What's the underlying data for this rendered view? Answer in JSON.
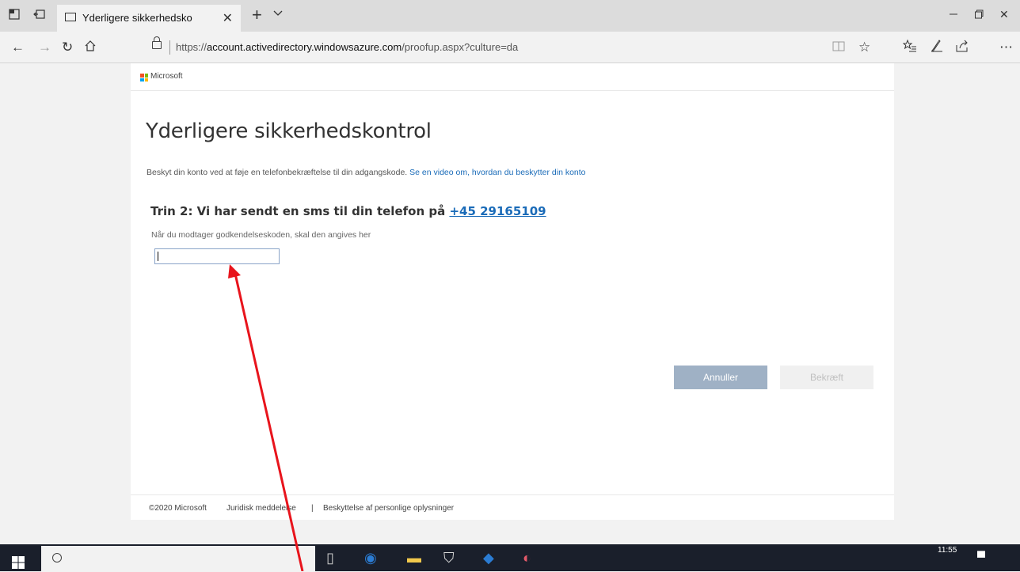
{
  "browser": {
    "tab_title": "Yderligere sikkerhedsko",
    "url_prefix": "https://",
    "url_domain": "account.activedirectory.windowsazure.com",
    "url_path": "/proofup.aspx?culture=da",
    "icons": {
      "tab_preview": "tab-preview-icon",
      "set_aside": "set-aside-tabs-icon",
      "page": "page-icon",
      "close_tab": "close-icon",
      "new_tab": "plus-icon",
      "tab_menu": "chevron-down-icon",
      "back": "arrow-left-icon",
      "forward": "arrow-right-icon",
      "refresh": "refresh-icon",
      "home": "home-icon",
      "lock": "lock-icon",
      "reading_view": "book-icon",
      "favorite": "star-icon",
      "favorites_hub": "favorites-list-icon",
      "notes": "pen-icon",
      "share": "share-icon",
      "more": "ellipsis-icon"
    }
  },
  "page": {
    "brand": "Microsoft",
    "brand_colors": [
      "#f25022",
      "#7fba00",
      "#00a4ef",
      "#ffb900"
    ],
    "title": "Yderligere sikkerhedskontrol",
    "description": "Beskyt din konto ved at føje en telefonbekræftelse til din adgangskode.",
    "description_link": "Se en video om, hvordan du beskytter din konto",
    "step_text": "Trin 2: Vi har sendt en sms til din telefon på",
    "phone": "+45 29165109",
    "help_text": "Når du modtager godkendelseskoden, skal den angives her",
    "code_value": "",
    "cancel_label": "Annuller",
    "confirm_label": "Bekræft",
    "footer": {
      "copyright": "©2020 Microsoft",
      "legal": "Juridisk meddelelse",
      "separator": "|",
      "privacy": "Beskyttelse af personlige oplysninger"
    }
  },
  "taskbar": {
    "time": "11:55"
  },
  "annotation": {
    "color": "#e8141c",
    "icon": "arrow-icon"
  }
}
